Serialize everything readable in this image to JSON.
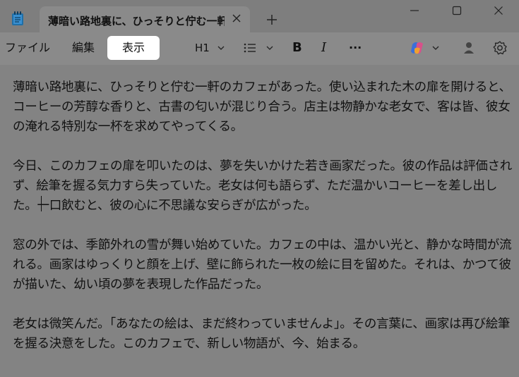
{
  "window": {
    "tab_title": "薄暗い路地裏に、ひっそりと佇む一軒の"
  },
  "menu": {
    "file": "ファイル",
    "edit": "編集",
    "view": "表示"
  },
  "toolbar": {
    "heading": "H1",
    "bold": "B",
    "italic": "I",
    "more": "···"
  },
  "document": {
    "paragraphs": [
      "薄暗い路地裏に、ひっそりと佇む一軒のカフェがあった。使い込まれた木の扉を開けると、コーヒーの芳醇な香りと、古書の匂いが混じり合う。店主は物静かな老女で、客は皆、彼女の淹れる特別な一杯を求めてやってくる。",
      "今日、このカフェの扉を叩いたのは、夢を失いかけた若き画家だった。彼の作品は評価されず、絵筆を握る気力すら失っていた。老女は何も語らず、ただ温かいコーヒーを差し出した。一口飲むと、彼の心に不思議な安らぎが広がった。",
      "窓の外では、季節外れの雪が舞い始めていた。カフェの中は、温かい光と、静かな時間が流れる。画家はゆっくりと顔を上げ、壁に飾られた一枚の絵に目を留めた。それは、かつて彼が描いた、幼い頃の夢を表現した作品だった。",
      "老女は微笑んだ。「あなたの絵は、まだ終わっていませんよ」。その言葉に、画家は再び絵筆を握る決意をした。このカフェで、新しい物語が、今、始まる。"
    ]
  }
}
